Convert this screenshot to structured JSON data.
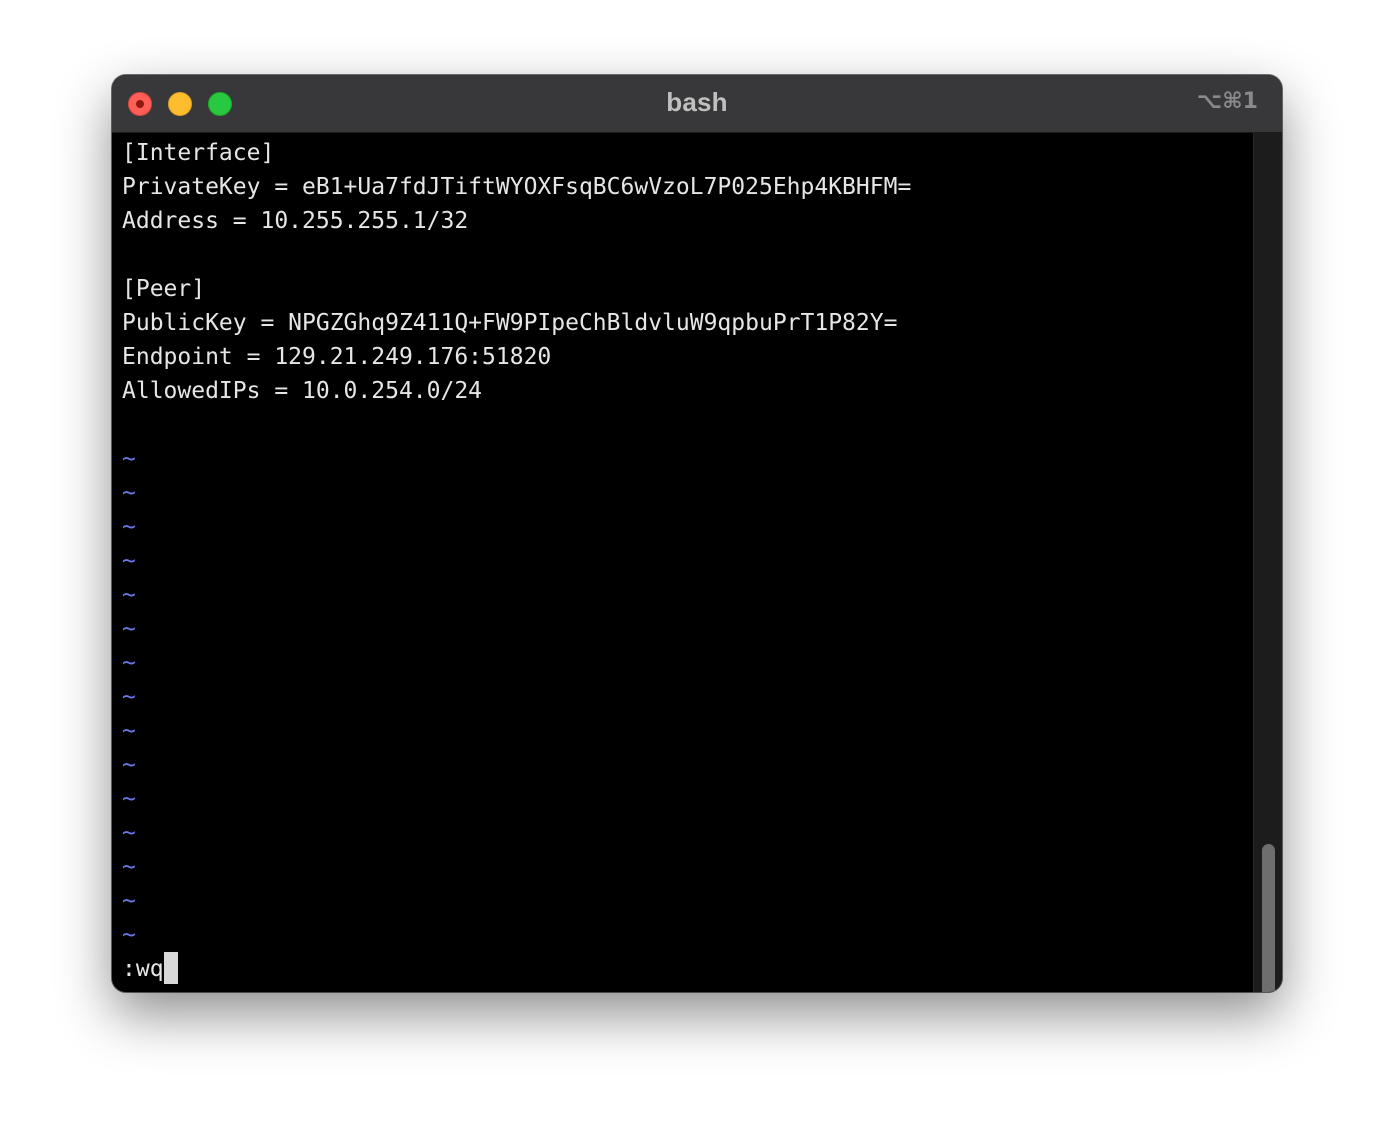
{
  "window": {
    "title": "bash",
    "shortcut": "⌥⌘1"
  },
  "editor": {
    "lines": [
      "[Interface]",
      "PrivateKey = eB1+Ua7fdJTiftWYOXFsqBC6wVzoL7P025Ehp4KBHFM=",
      "Address = 10.255.255.1/32",
      "",
      "[Peer]",
      "PublicKey = NPGZGhq9Z411Q+FW9PIpeChBldvluW9qpbuPrT1P82Y=",
      "Endpoint = 129.21.249.176:51820",
      "AllowedIPs = 10.0.254.0/24",
      ""
    ],
    "tilde": "~",
    "tilde_count": 15,
    "command": ":wq"
  },
  "colors": {
    "terminal_bg": "#000000",
    "text": "#e6e6e6",
    "tilde": "#6c78e8",
    "titlebar": "#38383a",
    "close": "#ff5f57",
    "minimize": "#febc2e",
    "zoom": "#28c840"
  },
  "icons": {
    "close": "close-icon",
    "minimize": "minimize-icon",
    "zoom": "zoom-icon"
  }
}
